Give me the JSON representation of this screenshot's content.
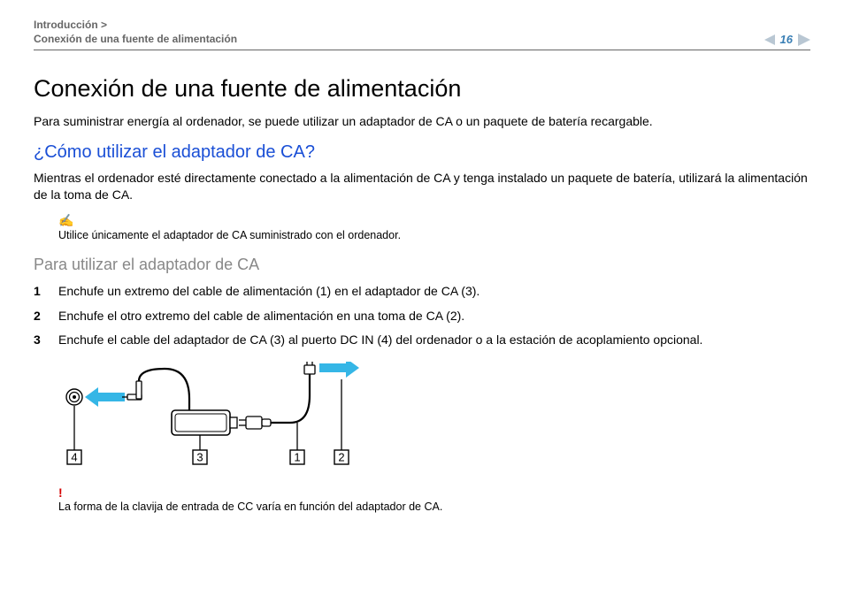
{
  "breadcrumb": {
    "line1": "Introducción >",
    "line2": "Conexión de una fuente de alimentación"
  },
  "page_number": "16",
  "title": "Conexión de una fuente de alimentación",
  "intro": "Para suministrar energía al ordenador, se puede utilizar un adaptador de CA o un paquete de batería recargable.",
  "subheading_blue": "¿Cómo utilizar el adaptador de CA?",
  "paragraph_blue": "Mientras el ordenador esté directamente conectado a la alimentación de CA y tenga instalado un paquete de batería, utilizará la alimentación de la toma de CA.",
  "note_text": "Utilice únicamente el adaptador de CA suministrado con el ordenador.",
  "subheading_gray": "Para utilizar el adaptador de CA",
  "steps": [
    "Enchufe un extremo del cable de alimentación (1) en el adaptador de CA (3).",
    "Enchufe el otro extremo del cable de alimentación en una toma de CA (2).",
    "Enchufe el cable del adaptador de CA (3) al puerto DC IN (4) del ordenador o a la estación de acoplamiento opcional."
  ],
  "callouts": {
    "c1": "1",
    "c2": "2",
    "c3": "3",
    "c4": "4"
  },
  "warn_text": "La forma de la clavija de entrada de CC varía en función del adaptador de CA."
}
